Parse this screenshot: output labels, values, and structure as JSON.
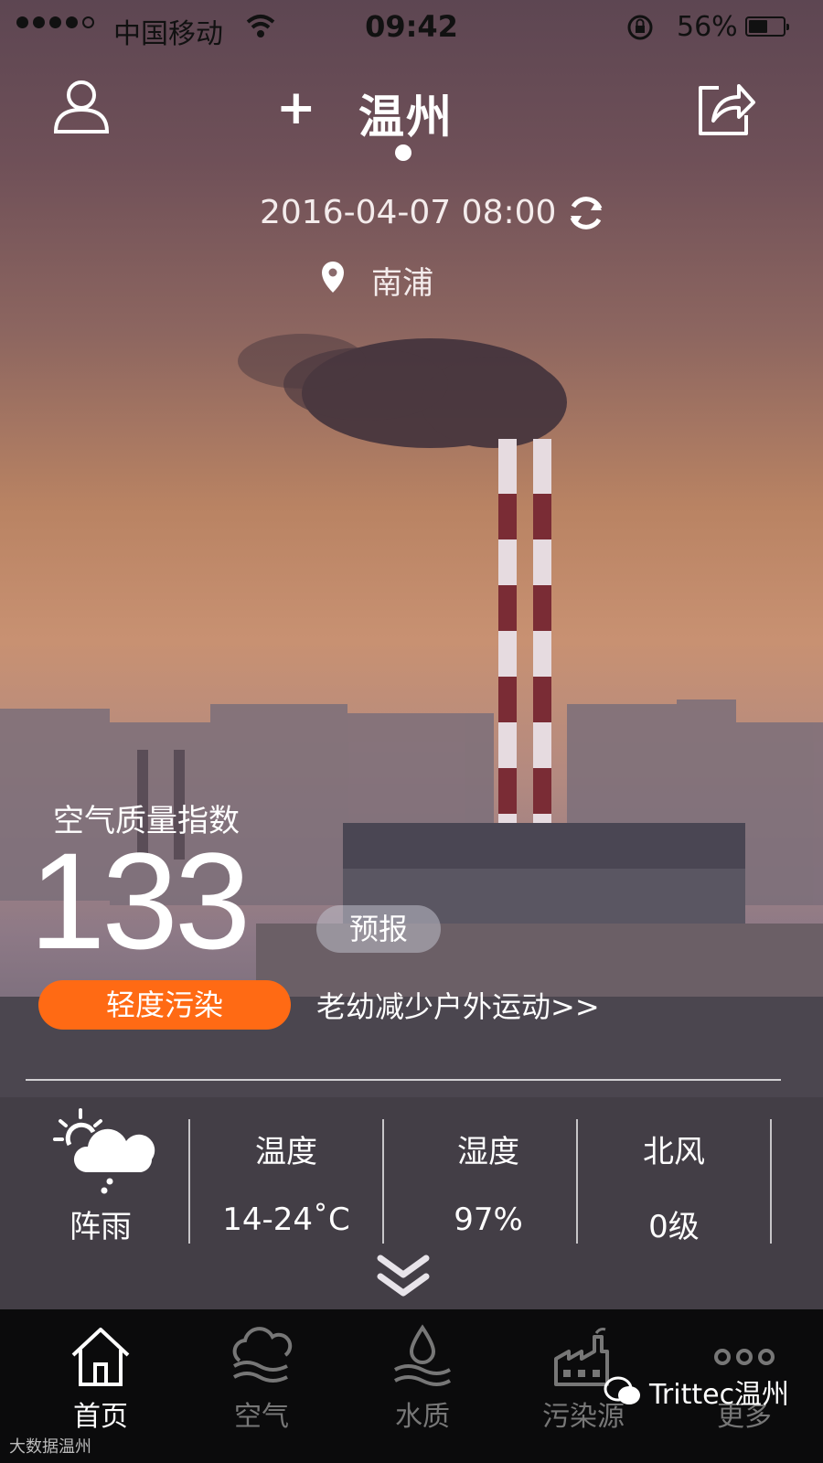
{
  "colors": {
    "accent": "#ff6a14",
    "tabbar_bg": "#0b0b0c",
    "forecast_pill": "#b4b4be"
  },
  "status_bar": {
    "carrier": "中国移动",
    "time": "09:42",
    "battery_percent": "56%",
    "battery_level": 0.56,
    "signal_bars": 4,
    "icons": [
      "signal-icon",
      "wifi-icon",
      "rotation-lock-icon",
      "battery-icon"
    ]
  },
  "header": {
    "add_label": "+",
    "city": "温州",
    "icons": [
      "user-icon",
      "share-icon"
    ]
  },
  "update": {
    "datetime": "2016-04-07 08:00"
  },
  "location": {
    "station": "南浦"
  },
  "aqi": {
    "title": "空气质量指数",
    "value": "133",
    "forecast_label": "预报",
    "level": "轻度污染",
    "advice": "老幼减少户外运动>>"
  },
  "weather": {
    "condition": "阵雨",
    "icon": "shower-rain-icon",
    "items": [
      {
        "label": "温度",
        "value": "14-24˚C"
      },
      {
        "label": "湿度",
        "value": "97%"
      },
      {
        "label": "北风",
        "value": "0级"
      }
    ]
  },
  "tabs": [
    {
      "label": "首页",
      "icon": "home-icon",
      "active": true
    },
    {
      "label": "空气",
      "icon": "air-icon",
      "active": false
    },
    {
      "label": "水质",
      "icon": "water-icon",
      "active": false
    },
    {
      "label": "污染源",
      "icon": "factory-icon",
      "active": false
    },
    {
      "label": "更多",
      "icon": "more-icon",
      "active": false
    }
  ],
  "watermark": {
    "text": "Trittec温州",
    "bottom_text": "大数据温州"
  }
}
